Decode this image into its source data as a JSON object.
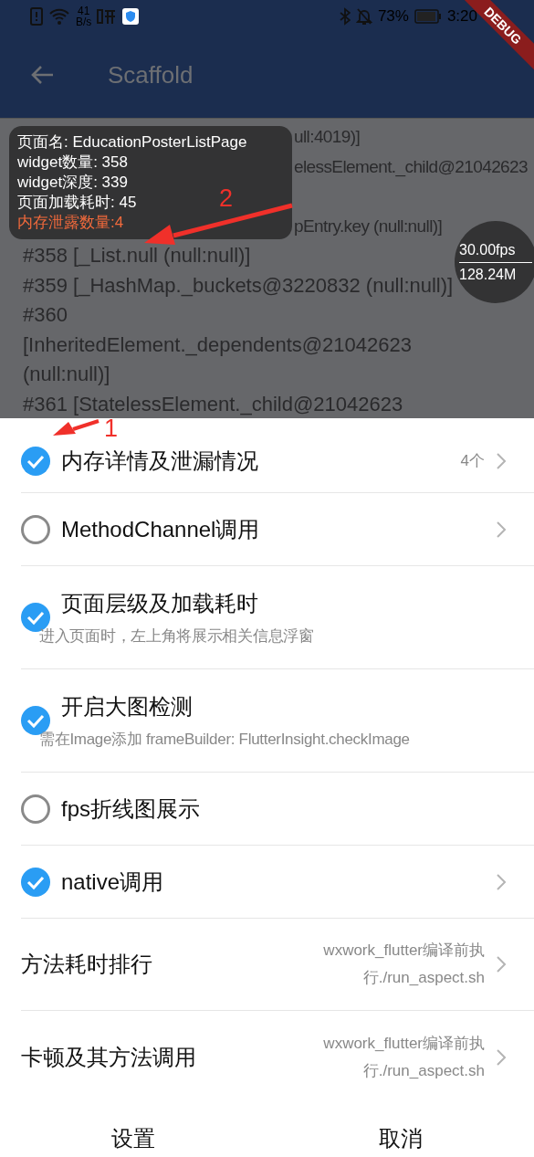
{
  "status_bar": {
    "speed_value": "41",
    "speed_unit": "B/s",
    "battery": "73%",
    "time": "3:20"
  },
  "debug_banner": "DEBUG",
  "app_bar": {
    "title": "Scaffold"
  },
  "log_fragments": [
    "ull:4019)]",
    "elessElement._child@21042623",
    "pEntry.key (null:null)]"
  ],
  "log_lines": [
    "#358    [_List.null (null:null)]",
    "#359    [_HashMap._buckets@3220832 (null:null)]",
    "#360",
    "[InheritedElement._dependents@21042623",
    "(null:null)]",
    "#361    [StatelessElement._child@21042623"
  ],
  "info_panel": {
    "lines": [
      {
        "text": "页面名: EducationPosterListPage",
        "warning": false
      },
      {
        "text": "widget数量: 358",
        "warning": false
      },
      {
        "text": "widget深度: 339",
        "warning": false
      },
      {
        "text": "页面加载耗时: 45",
        "warning": false
      },
      {
        "text": "内存泄露数量:4",
        "warning": true
      }
    ]
  },
  "perf_badge": {
    "fps": "30.00fps",
    "memory": "128.24M"
  },
  "annotations": [
    {
      "label": "1",
      "kind": "down_left"
    },
    {
      "label": "2",
      "kind": "left"
    }
  ],
  "settings": [
    {
      "kind": "checkbox",
      "checked": true,
      "title": "内存详情及泄漏情况",
      "trailing": "4个",
      "has_arrow": true
    },
    {
      "kind": "checkbox",
      "checked": false,
      "title": "MethodChannel调用",
      "has_arrow": true
    },
    {
      "kind": "checkbox",
      "checked": true,
      "title": "页面层级及加载耗时",
      "subtitle": "进入页面时，左上角将展示相关信息浮窗",
      "has_arrow": false
    },
    {
      "kind": "checkbox",
      "checked": true,
      "title": "开启大图检测",
      "subtitle": "需在Image添加 frameBuilder: FlutterInsight.checkImage",
      "has_arrow": false
    },
    {
      "kind": "checkbox",
      "checked": false,
      "title": "fps折线图展示",
      "has_arrow": false
    },
    {
      "kind": "checkbox",
      "checked": true,
      "title": "native调用",
      "has_arrow": true
    },
    {
      "kind": "plain",
      "title": "方法耗时排行",
      "trailing": "wxwork_flutter编译前执行./run_aspect.sh",
      "has_arrow": true
    },
    {
      "kind": "plain",
      "title": "卡顿及其方法调用",
      "trailing": "wxwork_flutter编译前执行./run_aspect.sh",
      "has_arrow": true
    }
  ],
  "buttons": [
    "设置",
    "取消"
  ]
}
